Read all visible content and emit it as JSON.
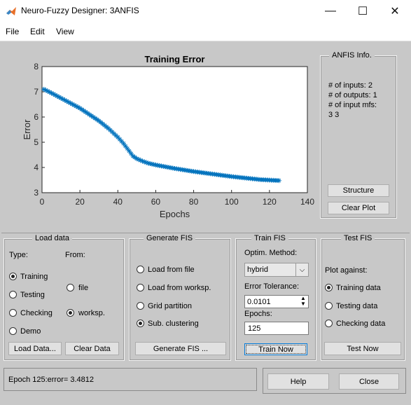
{
  "window": {
    "title": "Neuro-Fuzzy Designer: 3ANFIS",
    "minimize": "—",
    "maximize": "☐",
    "close": "✕"
  },
  "menu": [
    "File",
    "Edit",
    "View"
  ],
  "colors": {
    "accent": "#0072bd",
    "background": "#c8c8c8"
  },
  "chart_data": {
    "type": "scatter",
    "title": "Training Error",
    "xlabel": "Epochs",
    "ylabel": "Error",
    "xlim": [
      0,
      140
    ],
    "ylim": [
      3,
      8
    ],
    "xticks": [
      "0",
      "20",
      "40",
      "60",
      "80",
      "100",
      "120",
      "140"
    ],
    "yticks": [
      "3",
      "4",
      "5",
      "6",
      "7",
      "8"
    ],
    "marker": "asterisk",
    "series": [
      {
        "x": [
          1,
          5,
          10,
          15,
          20,
          25,
          30,
          35,
          40,
          43,
          46,
          48,
          50,
          53,
          56,
          60,
          65,
          70,
          75,
          80,
          85,
          90,
          95,
          100,
          105,
          110,
          115,
          120,
          125
        ],
        "y": [
          7.1,
          6.95,
          6.75,
          6.55,
          6.35,
          6.1,
          5.85,
          5.55,
          5.2,
          4.95,
          4.65,
          4.45,
          4.35,
          4.25,
          4.17,
          4.1,
          4.03,
          3.96,
          3.9,
          3.84,
          3.79,
          3.74,
          3.69,
          3.64,
          3.6,
          3.56,
          3.52,
          3.5,
          3.48
        ]
      }
    ]
  },
  "anfis_info": {
    "title": "ANFIS Info.",
    "lines": [
      "# of inputs: 2",
      "# of outputs: 1",
      "# of input mfs:",
      "3  3"
    ],
    "structure_button": "Structure",
    "clear_plot_button": "Clear Plot"
  },
  "load_data": {
    "title": "Load data",
    "type_label": "Type:",
    "from_label": "From:",
    "types": [
      "Training",
      "Testing",
      "Checking",
      "Demo"
    ],
    "from": [
      "file",
      "worksp."
    ],
    "load_button": "Load Data...",
    "clear_button": "Clear Data"
  },
  "generate_fis": {
    "title": "Generate FIS",
    "options": [
      "Load from file",
      "Load from worksp.",
      "Grid partition",
      "Sub. clustering"
    ],
    "button": "Generate FIS ..."
  },
  "train_fis": {
    "title": "Train FIS",
    "method_label": "Optim. Method:",
    "method_value": "hybrid",
    "tolerance_label": "Error Tolerance:",
    "tolerance_value": "0.0101",
    "epochs_label": "Epochs:",
    "epochs_value": "125",
    "button": "Train Now"
  },
  "test_fis": {
    "title": "Test FIS",
    "plot_against_label": "Plot against:",
    "options": [
      "Training data",
      "Testing data",
      "Checking data"
    ],
    "button": "Test Now"
  },
  "status": {
    "text": "Epoch 125:error= 3.4812"
  },
  "help_button": "Help",
  "close_button": "Close"
}
